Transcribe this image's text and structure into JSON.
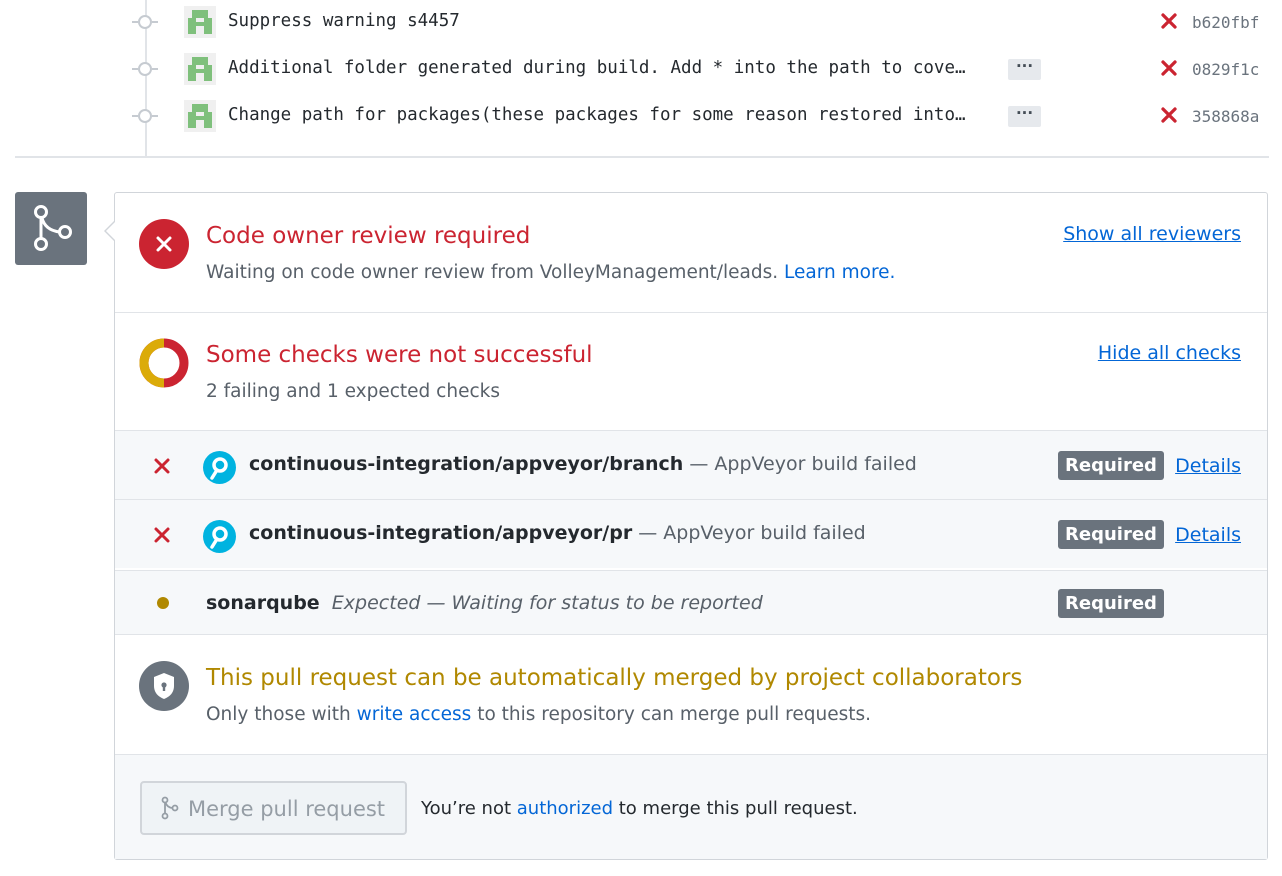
{
  "commits": [
    {
      "message": "Suppress warning s4457",
      "sha": "b620fbf",
      "has_more": false
    },
    {
      "message": "Additional folder generated during build. Add * into the path to cove…",
      "sha": "0829f1c",
      "has_more": true
    },
    {
      "message": "Change path for packages(these packages for some reason restored into…",
      "sha": "358868a",
      "has_more": true
    }
  ],
  "ellipsis_label": "···",
  "review": {
    "title": "Code owner review required",
    "subtitle_prefix": "Waiting on code owner review from VolleyManagement/leads. ",
    "learn_more": "Learn more.",
    "show_all": "Show all reviewers"
  },
  "checks_summary": {
    "title": "Some checks were not successful",
    "subtitle": "2 failing and 1 expected checks",
    "hide_all": "Hide all checks"
  },
  "checks": [
    {
      "name": "continuous-integration/appveyor/branch",
      "description": " — AppVeyor build failed",
      "badge": "Required",
      "details": "Details",
      "status": "failure"
    },
    {
      "name": "continuous-integration/appveyor/pr",
      "description": " — AppVeyor build failed",
      "badge": "Required",
      "details": "Details",
      "status": "failure"
    },
    {
      "name": "sonarqube",
      "description": "Expected — Waiting for status to be reported",
      "badge": "Required",
      "status": "expected"
    }
  ],
  "merge_info": {
    "title": "This pull request can be automatically merged by project collaborators",
    "subtitle_prefix": "Only those with ",
    "write_access": "write access",
    "subtitle_suffix": " to this repository can merge pull requests."
  },
  "merge_footer": {
    "button_label": "Merge pull request",
    "note_prefix": "You’re not ",
    "authorized": "authorized",
    "note_suffix": " to merge this pull request."
  },
  "colors": {
    "failure": "#cb2431",
    "pending": "#dbab09",
    "expected": "#b08800",
    "link": "#0366d6",
    "badge": "#6a737d"
  }
}
